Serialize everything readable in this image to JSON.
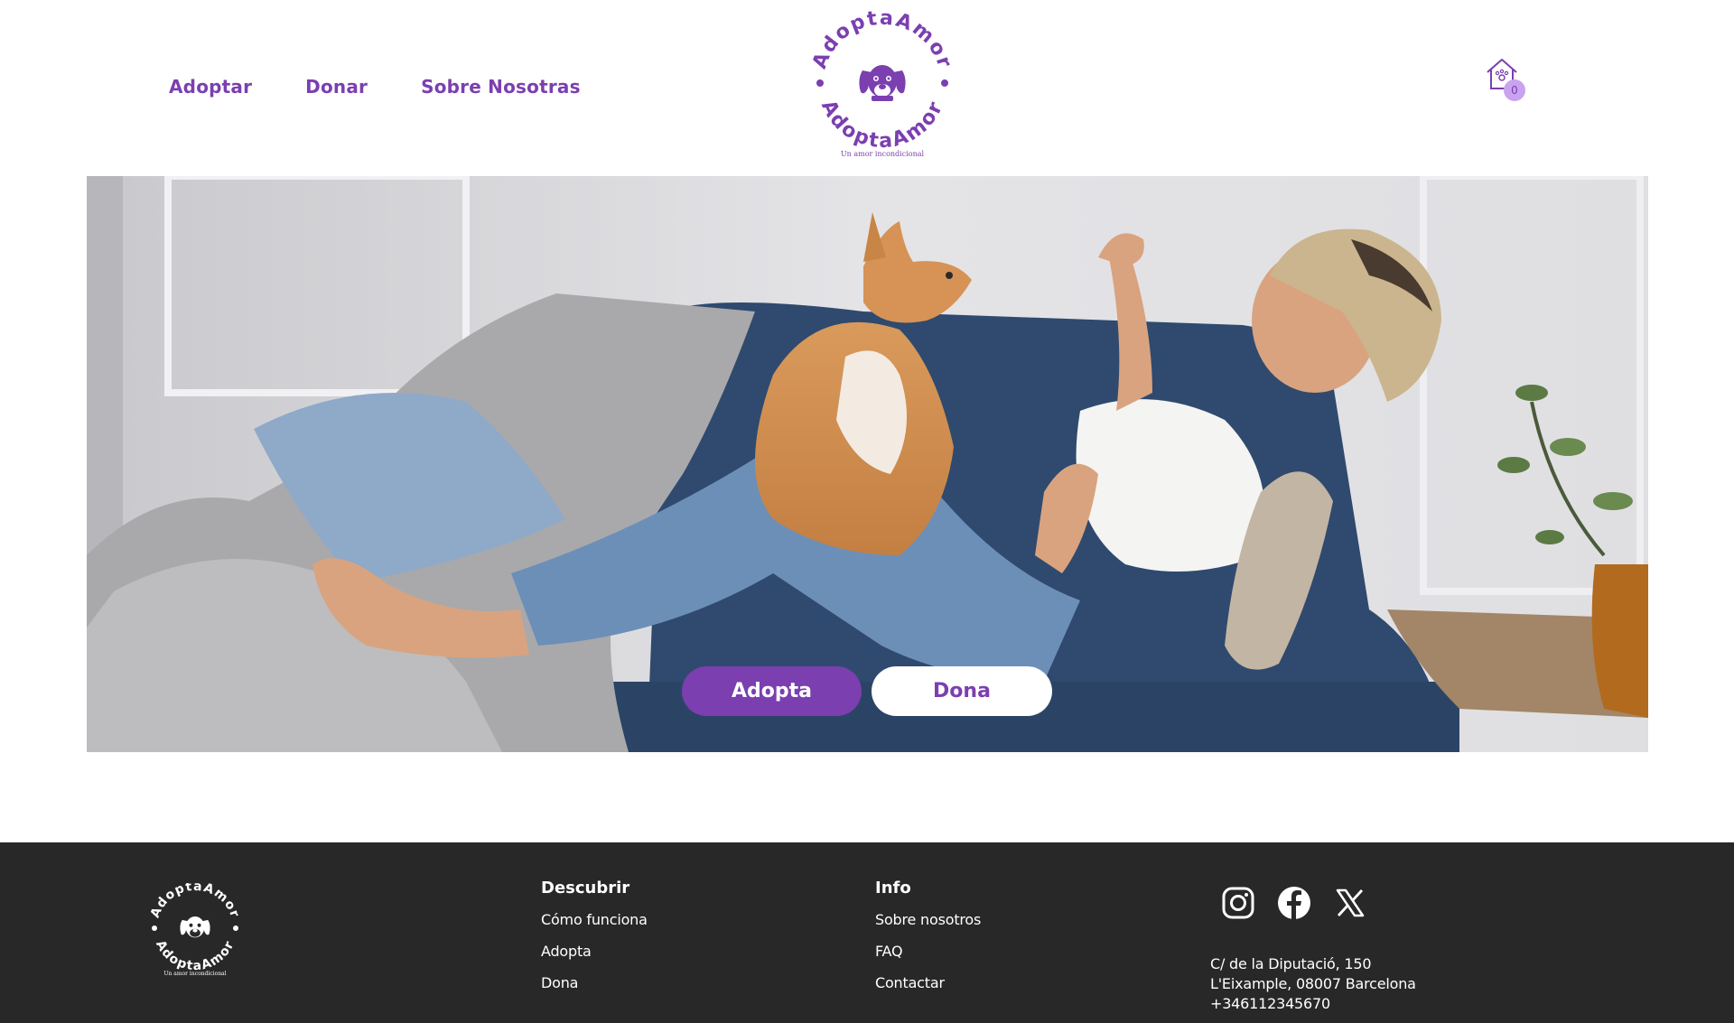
{
  "nav": {
    "items": [
      {
        "label": "Adoptar"
      },
      {
        "label": "Donar"
      },
      {
        "label": "Sobre Nosotras"
      }
    ]
  },
  "logo": {
    "top_text": "AdoptaAmor",
    "bottom_text": "AdoptaAmor",
    "tagline": "Un amor incondicional"
  },
  "cart": {
    "icon": "house-paw-icon",
    "count": "0"
  },
  "hero": {
    "adopta_label": "Adopta",
    "dona_label": "Dona"
  },
  "footer": {
    "logo_tagline": "Un amor incondicional",
    "descubrir": {
      "title": "Descubrir",
      "links": [
        "Cómo funciona",
        "Adopta",
        "Dona"
      ]
    },
    "info": {
      "title": "Info",
      "links": [
        "Sobre nosotros",
        "FAQ",
        "Contactar"
      ]
    },
    "socials": [
      "instagram-icon",
      "facebook-icon",
      "x-icon"
    ],
    "address": {
      "line1": "C/ de la Diputació, 150",
      "line2": "L'Eixample, 08007 Barcelona",
      "line3": "+346112345670"
    }
  },
  "colors": {
    "brand_purple": "#7b3fb0",
    "badge_lilac": "#c9a3ef",
    "footer_bg": "#282828"
  }
}
